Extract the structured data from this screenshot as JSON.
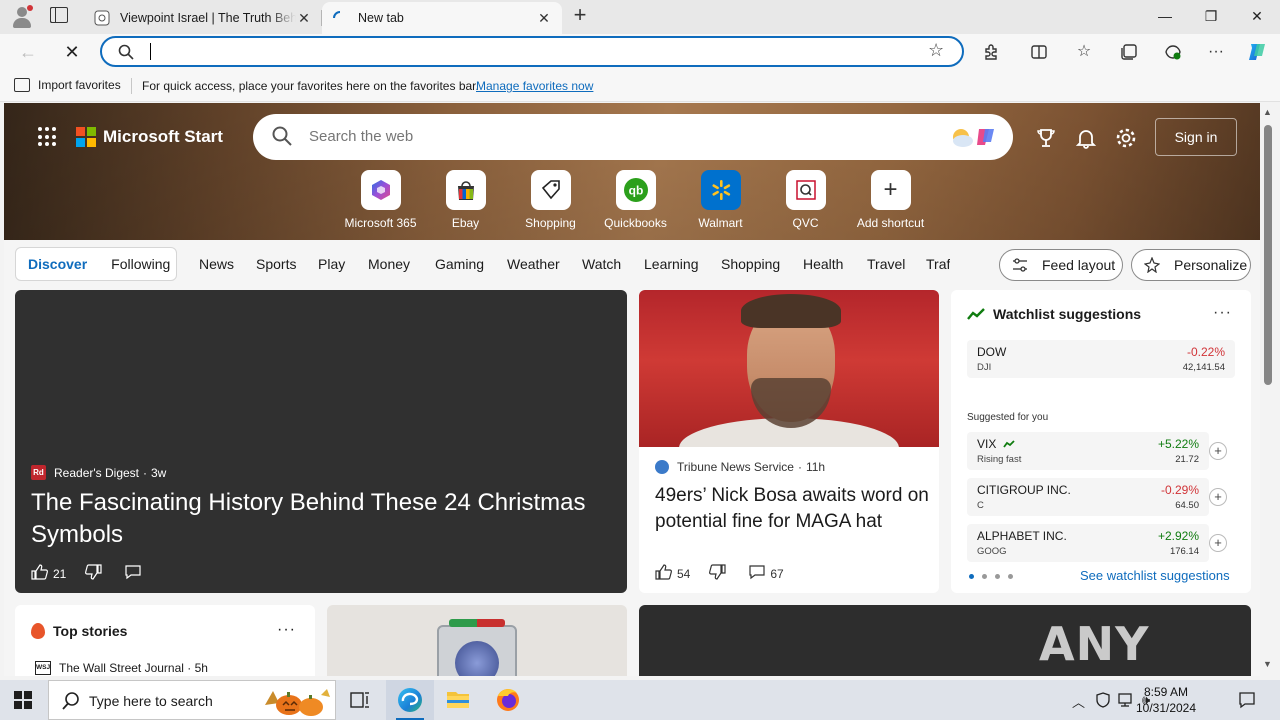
{
  "browser": {
    "tabs": [
      {
        "title": "Viewpoint Israel | The Truth Behind",
        "active": false
      },
      {
        "title": "New tab",
        "active": true
      }
    ],
    "address_value": "",
    "favorites_bar": {
      "import_label": "Import favorites",
      "hint": "For quick access, place your favorites here on the favorites bar.",
      "manage_link": "Manage favorites now"
    },
    "window_controls": {
      "minimize": "—",
      "maximize": "❐",
      "close": "✕"
    }
  },
  "newtab": {
    "brand": "Microsoft Start",
    "search_placeholder": "Search the web",
    "sign_in": "Sign in",
    "shortcuts": [
      {
        "label": "Microsoft 365",
        "icon": "m365-icon"
      },
      {
        "label": "Ebay",
        "icon": "ebay-icon"
      },
      {
        "label": "Shopping",
        "icon": "tag-icon"
      },
      {
        "label": "Quickbooks",
        "icon": "quickbooks-icon"
      },
      {
        "label": "Walmart",
        "icon": "walmart-icon"
      },
      {
        "label": "QVC",
        "icon": "qvc-icon"
      },
      {
        "label": "Add shortcut",
        "icon": "plus-icon"
      }
    ],
    "feed_tabs": [
      "Discover",
      "Following"
    ],
    "categories": [
      "News",
      "Sports",
      "Play",
      "Money",
      "Gaming",
      "Weather",
      "Watch",
      "Learning",
      "Shopping",
      "Health",
      "Travel",
      "Traf"
    ],
    "feed_layout": "Feed layout",
    "personalize": "Personalize",
    "feature_story": {
      "source": "Reader's Digest",
      "age": "3w",
      "headline": "The Fascinating History Behind These 24 Christmas Symbols",
      "likes": "21"
    },
    "news_story": {
      "source": "Tribune News Service",
      "age": "11h",
      "headline": "49ers’ Nick Bosa awaits word on potential fine for MAGA hat",
      "likes": "54",
      "comments": "67"
    },
    "watchlist": {
      "title": "Watchlist suggestions",
      "main": {
        "name": "DOW",
        "symbol": "DJI",
        "change": "-0.22%",
        "price": "42,141.54"
      },
      "suggested_label": "Suggested for you",
      "suggestions": [
        {
          "name": "VIX",
          "symbol": "Rising fast",
          "change": "+5.22%",
          "price": "21.72",
          "dir": "up"
        },
        {
          "name": "CITIGROUP INC.",
          "symbol": "C",
          "change": "-0.29%",
          "price": "64.50",
          "dir": "down"
        },
        {
          "name": "ALPHABET INC.",
          "symbol": "GOOG",
          "change": "+2.92%",
          "price": "176.14",
          "dir": "up"
        }
      ],
      "see_all": "See watchlist suggestions"
    },
    "top_stories": {
      "title": "Top stories",
      "source": "The Wall Street Journal · 5h",
      "source_logo": "WSJ"
    },
    "watermark": "ANY RUN"
  },
  "taskbar": {
    "search_placeholder": "Type here to search",
    "time": "8:59 AM",
    "date": "10/31/2024"
  },
  "colors": {
    "accent": "#0f6cbd",
    "up": "#107c10",
    "down": "#d13438"
  }
}
